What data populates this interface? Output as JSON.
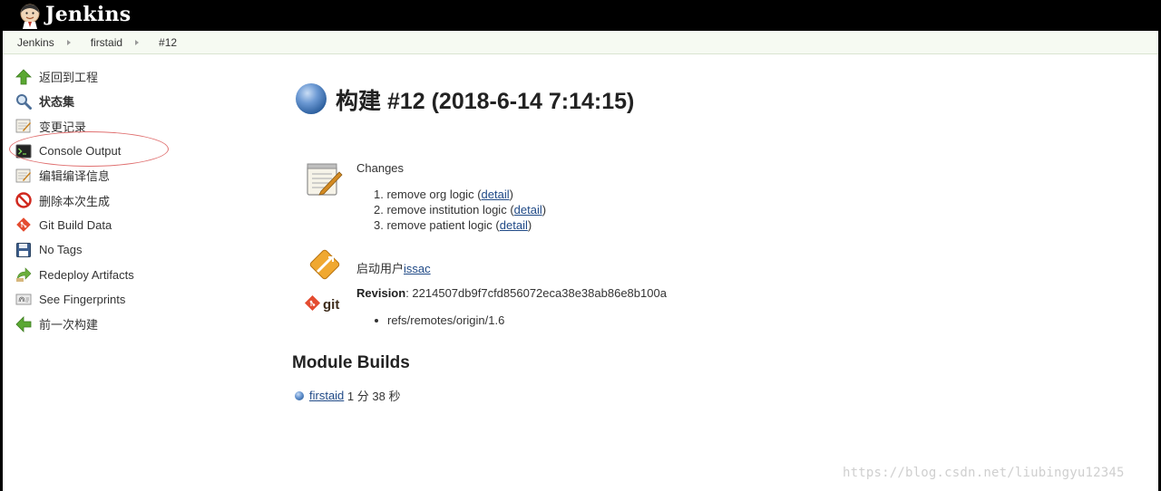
{
  "header": {
    "brand": "Jenkins"
  },
  "breadcrumb": [
    "Jenkins",
    "firstaid",
    "#12"
  ],
  "sidebar": {
    "items": [
      {
        "label": "返回到工程",
        "icon": "up-arrow-icon"
      },
      {
        "label": "状态集",
        "icon": "search-icon"
      },
      {
        "label": "变更记录",
        "icon": "notepad-icon"
      },
      {
        "label": "Console Output",
        "icon": "terminal-icon"
      },
      {
        "label": "编辑编译信息",
        "icon": "notepad-icon"
      },
      {
        "label": "删除本次生成",
        "icon": "no-entry-icon"
      },
      {
        "label": "Git Build Data",
        "icon": "git-icon"
      },
      {
        "label": "No Tags",
        "icon": "save-icon"
      },
      {
        "label": "Redeploy Artifacts",
        "icon": "redeploy-icon"
      },
      {
        "label": "See Fingerprints",
        "icon": "fingerprint-icon"
      },
      {
        "label": "前一次构建",
        "icon": "left-arrow-icon"
      }
    ]
  },
  "main": {
    "title": "构建 #12 (2018-6-14 7:14:15)",
    "changes": {
      "heading": "Changes",
      "items": [
        {
          "num": "1.",
          "text": "remove org logic",
          "link": "detail"
        },
        {
          "num": "2.",
          "text": "remove institution logic",
          "link": "detail"
        },
        {
          "num": "3.",
          "text": "remove patient logic",
          "link": "detail"
        }
      ]
    },
    "started_by": {
      "prefix": "启动用户",
      "user": "issac"
    },
    "git": {
      "revision_label": "Revision",
      "revision_value": "2214507db9f7cfd856072eca38e38ab86e8b100a",
      "ref": "refs/remotes/origin/1.6"
    },
    "module_builds": {
      "heading": "Module Builds",
      "items": [
        {
          "name": "firstaid",
          "duration": "1 分 38 秒"
        }
      ]
    }
  },
  "watermark": "https://blog.csdn.net/liubingyu12345",
  "colors": {
    "header_bg": "#000000",
    "link": "#204a87",
    "breadcrumb_bg": "#f6faf2",
    "highlight_ellipse": "#e07070"
  }
}
